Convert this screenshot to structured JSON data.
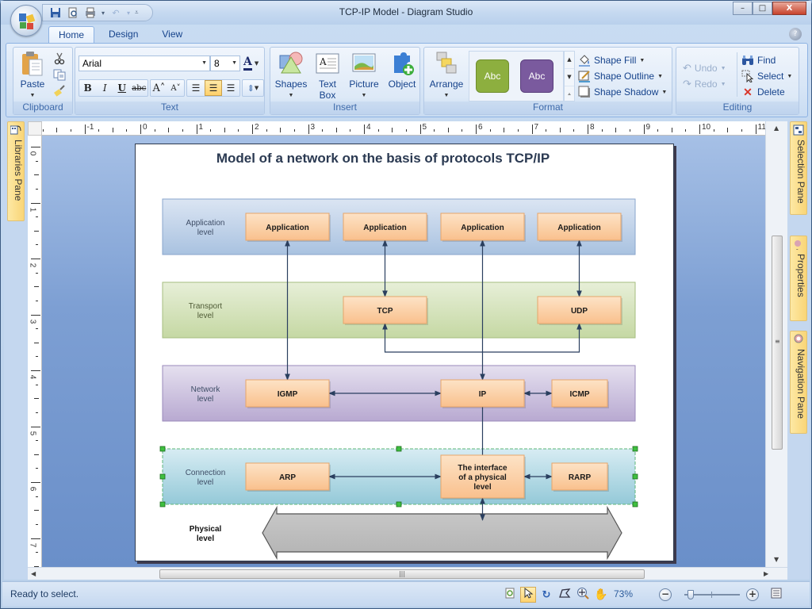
{
  "window": {
    "title": "TCP-IP Model - Diagram Studio",
    "controls": {
      "minimize": "–",
      "maximize": "□",
      "close": "X"
    }
  },
  "quick_access": {
    "items": [
      "save-icon",
      "print-preview-icon",
      "print-icon",
      "undo-icon",
      "customize-icon"
    ]
  },
  "tabs": [
    {
      "label": "Home",
      "active": true
    },
    {
      "label": "Design",
      "active": false
    },
    {
      "label": "View",
      "active": false
    }
  ],
  "ribbon": {
    "clipboard": {
      "label": "Clipboard",
      "paste": "Paste"
    },
    "text": {
      "label": "Text",
      "font": "Arial",
      "size": "8",
      "bold": "B",
      "italic": "I",
      "underline": "U",
      "strike": "abc",
      "grow": "A˄",
      "shrink": "A˅"
    },
    "insert": {
      "label": "Insert",
      "shapes": "Shapes",
      "textbox_line1": "Text",
      "textbox_line2": "Box",
      "picture": "Picture",
      "object": "Object"
    },
    "format": {
      "label": "Format",
      "arrange": "Arrange",
      "style1": {
        "label": "Abc",
        "color": "#8daf3f"
      },
      "style2": {
        "label": "Abc",
        "color": "#7a5a9e"
      },
      "shape_fill": "Shape Fill",
      "shape_outline": "Shape Outline",
      "shape_shadow": "Shape Shadow"
    },
    "editing": {
      "label": "Editing",
      "undo": "Undo",
      "redo": "Redo",
      "find": "Find",
      "select": "Select",
      "delete": "Delete"
    }
  },
  "panes": {
    "left": "Libraries Pane",
    "right": [
      "Selection Pane",
      "Properties",
      "Navigation Pane"
    ]
  },
  "rulers": {
    "horizontal": [
      "-1",
      "0",
      "1",
      "2",
      "3",
      "4",
      "5",
      "6",
      "7",
      "8",
      "9",
      "10",
      "11"
    ],
    "vertical": [
      "0",
      "1",
      "2",
      "3",
      "4",
      "5",
      "6",
      "7"
    ]
  },
  "diagram": {
    "title": "Model of a network on the basis of protocols TCP/IP",
    "levels": [
      {
        "id": "application",
        "label_line1": "Application",
        "label_line2": "level",
        "color_top": "#dbe5f3",
        "color_bottom": "#a9c2e0",
        "border": "#8aa6cc"
      },
      {
        "id": "transport",
        "label_line1": "Transport",
        "label_line2": "level",
        "color_top": "#e7efd8",
        "color_bottom": "#c5d8a3",
        "border": "#a6bd7f"
      },
      {
        "id": "network",
        "label_line1": "Network",
        "label_line2": "level",
        "color_top": "#e5e0ef",
        "color_bottom": "#b8a9d1",
        "border": "#9a8abb"
      },
      {
        "id": "connection",
        "label_line1": "Connection",
        "label_line2": "level",
        "color_top": "#d7ecf3",
        "color_bottom": "#94c9d8",
        "border": "#5fb77a",
        "selected": true
      },
      {
        "id": "physical",
        "label_line1": "Physical",
        "label_line2": "level"
      }
    ],
    "nodes": [
      {
        "id": "app1",
        "label": "Application"
      },
      {
        "id": "app2",
        "label": "Application"
      },
      {
        "id": "app3",
        "label": "Application"
      },
      {
        "id": "app4",
        "label": "Application"
      },
      {
        "id": "tcp",
        "label": "TCP"
      },
      {
        "id": "udp",
        "label": "UDP"
      },
      {
        "id": "igmp",
        "label": "IGMP"
      },
      {
        "id": "ip",
        "label": "IP"
      },
      {
        "id": "icmp",
        "label": "ICMP"
      },
      {
        "id": "arp",
        "label": "ARP"
      },
      {
        "id": "phys_iface",
        "label_lines": [
          "The interface",
          "of a physical",
          "level"
        ]
      },
      {
        "id": "rarp",
        "label": "RARP"
      }
    ],
    "node_colors": {
      "top": "#fde3c6",
      "bottom": "#f9c08d",
      "border": "#e6a56a"
    },
    "connector_color": "#2a3f5f"
  },
  "status": {
    "text": "Ready to select.",
    "zoom": "73%",
    "zoom_level_fraction": 0.12,
    "tools": [
      "page-icon",
      "pointer-icon",
      "rotate-icon",
      "connector-icon",
      "zoom-icon",
      "pan-hand-icon"
    ],
    "active_tool": 1
  }
}
